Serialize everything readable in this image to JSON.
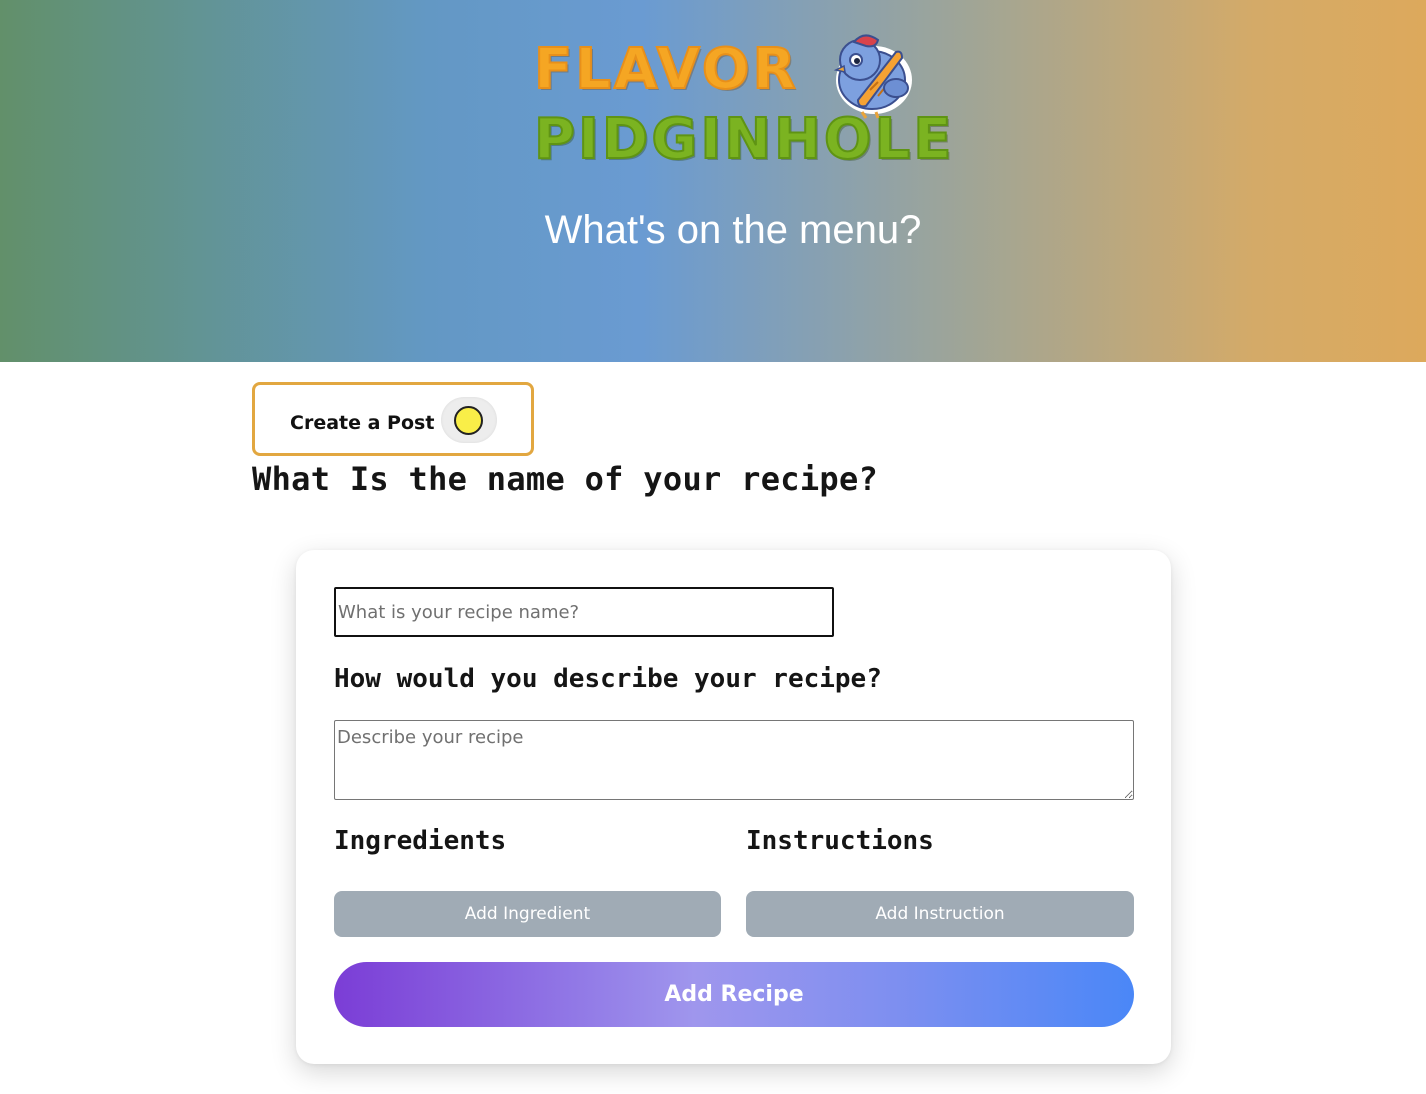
{
  "header": {
    "logo": {
      "line1": "FLAVOR",
      "line2": "PIDGINHOLE",
      "mascot": "pigeon-mascot-icon"
    },
    "tagline": "What's on the menu?"
  },
  "toggle_card": {
    "label": "Create a Post",
    "toggle_state": "on",
    "knob_color": "#f9ee48",
    "border_color": "#e2a740"
  },
  "form": {
    "name_question": "What Is the name of your recipe?",
    "name_input": {
      "value": "",
      "placeholder": "What is your recipe name?"
    },
    "desc_question": "How would you describe your recipe?",
    "desc_input": {
      "value": "",
      "placeholder": "Describe your recipe"
    },
    "ingredients": {
      "heading": "Ingredients",
      "button": "Add Ingredient"
    },
    "instructions": {
      "heading": "Instructions",
      "button": "Add Instruction"
    },
    "submit_button": "Add Recipe"
  },
  "colors": {
    "hero_gradient": [
      "#62906a",
      "#6a9bd2",
      "#dda95c"
    ],
    "secondary_button": "#a0abb5",
    "submit_gradient": [
      "#7b3dd6",
      "#9f96ed",
      "#4a87f7"
    ]
  }
}
